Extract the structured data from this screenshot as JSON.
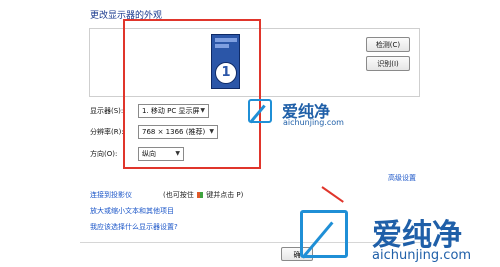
{
  "page": {
    "title": "更改显示器的外观"
  },
  "preview": {
    "monitor_number": "1"
  },
  "buttons": {
    "detect": "检测(C)",
    "identify": "识别(I)",
    "ok_partial": "确"
  },
  "settings": {
    "display": {
      "label": "显示器(S):",
      "value": "1. 移动 PC 显示屏"
    },
    "resolution": {
      "label": "分辨率(R):",
      "value": "768 × 1366 (推荐)"
    },
    "orientation": {
      "label": "方向(O):",
      "value": "纵向"
    }
  },
  "links": {
    "advanced": "高级设置",
    "projector": "连接到投影仪",
    "projector_rest_a": "(也可按住",
    "projector_rest_b": "键并点击 P)",
    "enlarge": "放大或缩小文本和其他项目",
    "choose": "我应该选择什么显示器设置?"
  },
  "watermark": {
    "brand": "爱纯净",
    "url": "aichunjing.com"
  },
  "colors": {
    "annotation": "#e0352b",
    "link": "#1a55c8",
    "title": "#1a3a8f",
    "watermark": "#1f8fd6"
  }
}
